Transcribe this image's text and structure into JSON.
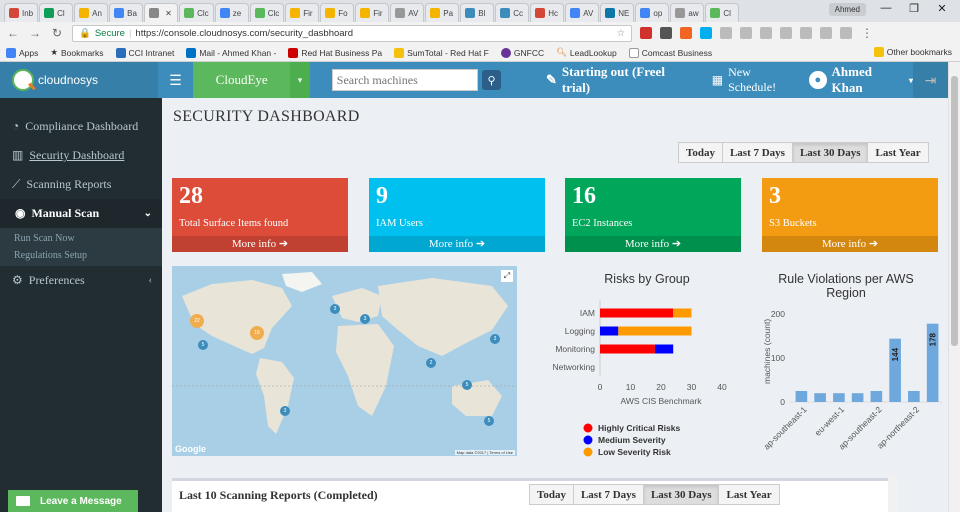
{
  "browser": {
    "tabs": [
      {
        "label": "Inb",
        "color": "#d44638"
      },
      {
        "label": "Cl",
        "color": "#0f9d58"
      },
      {
        "label": "An",
        "color": "#f4b400"
      },
      {
        "label": "Ba",
        "color": "#4285f4"
      },
      {
        "label": "",
        "color": "#888888",
        "active": true
      },
      {
        "label": "Clc",
        "color": "#5cb85c"
      },
      {
        "label": "ze",
        "color": "#4285f4"
      },
      {
        "label": "Clc",
        "color": "#5cb85c"
      },
      {
        "label": "Fir",
        "color": "#f4b400"
      },
      {
        "label": "Fo",
        "color": "#f4b400"
      },
      {
        "label": "Fir",
        "color": "#f4b400"
      },
      {
        "label": "AV",
        "color": "#999999"
      },
      {
        "label": "Pa",
        "color": "#f4b400"
      },
      {
        "label": "Bl",
        "color": "#3c8dbc"
      },
      {
        "label": "Cc",
        "color": "#3c8dbc"
      },
      {
        "label": "Hc",
        "color": "#d44638"
      },
      {
        "label": "AV",
        "color": "#4285f4"
      },
      {
        "label": "NE",
        "color": "#0e76a8"
      },
      {
        "label": "op",
        "color": "#4285f4"
      },
      {
        "label": "aw",
        "color": "#999999"
      },
      {
        "label": "Cl",
        "color": "#5cb85c"
      }
    ],
    "profile": "Ahmed",
    "secure_label": "Secure",
    "url": "https://console.cloudnosys.com/security_dasbhoard",
    "bookmarks": [
      "Apps",
      "Bookmarks",
      "CCI Intranet",
      "Mail - Ahmed Khan -",
      "Red Hat Business Pa",
      "SumTotal - Red Hat F",
      "GNFCC",
      "LeadLookup",
      "Comcast Business"
    ],
    "other_bookmarks": "Other bookmarks"
  },
  "header": {
    "logo_text": "cloudnosys",
    "product": "CloudEye",
    "search_placeholder": "Search machines",
    "trial": "Starting out (Freel trial)",
    "schedule": "New Schedule!",
    "user": "Ahmed Khan"
  },
  "sidebar": {
    "items": [
      {
        "label": "Compliance Dashboard",
        "icon": "dashboard-icon"
      },
      {
        "label": "Security Dashboard",
        "icon": "bar-chart-icon"
      },
      {
        "label": "Scanning Reports",
        "icon": "line-chart-icon"
      },
      {
        "label": "Manual Scan",
        "icon": "eye-icon"
      },
      {
        "label": "Preferences",
        "icon": "gears-icon"
      }
    ],
    "submenu": [
      "Run Scan Now",
      "Regulations Setup"
    ],
    "leave_message": "Leave a Message"
  },
  "main": {
    "title": "SECURITY DASHBOARD",
    "ranges": [
      "Today",
      "Last 7 Days",
      "Last 30 Days",
      "Last Year"
    ],
    "selected_range": "Last 30 Days",
    "more_info": "More info",
    "stats": [
      {
        "value": "28",
        "label": "Total Surface Items found",
        "color": "#dd4b39"
      },
      {
        "value": "9",
        "label": "IAM Users",
        "color": "#00c0ef"
      },
      {
        "value": "16",
        "label": "EC2 Instances",
        "color": "#00a65a"
      },
      {
        "value": "3",
        "label": "S3 Buckets",
        "color": "#f39c12"
      }
    ],
    "map": {
      "google_label": "Google",
      "attribution": "Map data ©2017 | Terms of Use",
      "cluster_labels": [
        "22",
        "16",
        "5",
        "3",
        "3",
        "2",
        "3",
        "5",
        "3",
        "5"
      ]
    },
    "reports_title": "Last 10 Scanning Reports (Completed)"
  },
  "chart_data": [
    {
      "type": "bar",
      "orientation": "horizontal",
      "stacked": true,
      "title": "Risks by Group",
      "xlabel": "AWS CIS Benchmark",
      "categories": [
        "IAM",
        "Logging",
        "Monitoring",
        "Networking"
      ],
      "xlim": [
        0,
        40
      ],
      "xticks": [
        0,
        10,
        20,
        30,
        40
      ],
      "series": [
        {
          "name": "Highly Critical Risks",
          "color": "#ff0000",
          "values": [
            24,
            0,
            18,
            0
          ]
        },
        {
          "name": "Medium Severity",
          "color": "#0000ff",
          "values": [
            0,
            6,
            6,
            0
          ]
        },
        {
          "name": "Low Severity Risk",
          "color": "#ff9900",
          "values": [
            6,
            24,
            0,
            0
          ]
        }
      ]
    },
    {
      "type": "bar",
      "title": "Rule Violations per AWS Region",
      "ylabel": "machines (count)",
      "categories": [
        "ap-southeast-1",
        "",
        "eu-west-1",
        "",
        "ap-southeast-2",
        "",
        "ap-northeast-2",
        ""
      ],
      "values": [
        25,
        20,
        20,
        20,
        25,
        144,
        25,
        178
      ],
      "data_labels": [
        "",
        "",
        "",
        "",
        "",
        "144",
        "",
        "178"
      ],
      "ylim": [
        0,
        200
      ],
      "yticks": [
        0,
        100,
        200
      ],
      "color": "#6fa8dc"
    }
  ]
}
